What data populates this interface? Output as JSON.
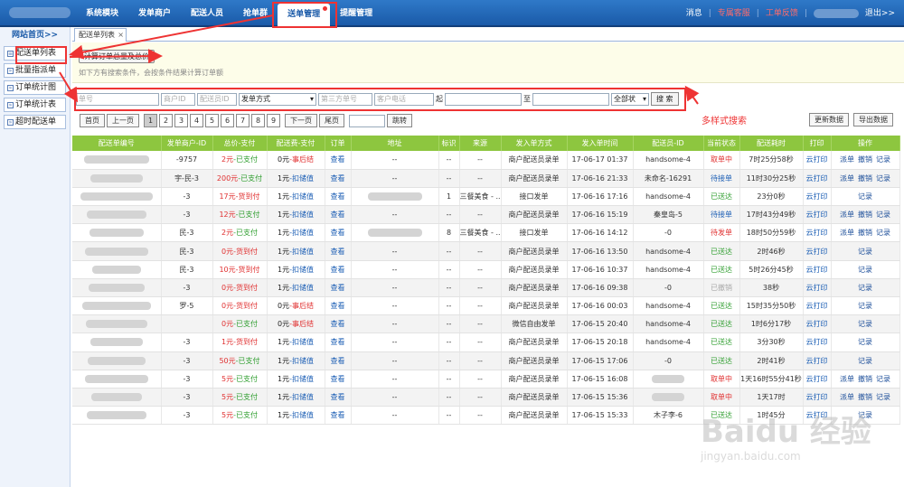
{
  "topnav": {
    "items": [
      "系统模块",
      "发单商户",
      "配送人员",
      "抢单群",
      "送单管理",
      "提醒管理"
    ],
    "active_index": 4,
    "right": {
      "message": "消息",
      "support": "专属客服",
      "feedback": "工单反馈",
      "logout": "退出>>"
    }
  },
  "sidebar": {
    "home": "网站首页>>",
    "items": [
      "配送单列表",
      "批量指派单",
      "订单统计图",
      "订单统计表",
      "超时配送单"
    ]
  },
  "tab": {
    "label": "配送单列表",
    "close": "×"
  },
  "panel": {
    "calc_button": "计算订单总量及总价",
    "hint": "如下方有搜索条件，会按条件结果计算订单额"
  },
  "search": {
    "order_no": "单号",
    "merchant_id": "商户ID",
    "courier_id": "配送员ID",
    "send_type": "发单方式",
    "third_no": "第三方单号",
    "phone": "客户电话",
    "from": "起",
    "to": "至",
    "status": "全部状",
    "button": "搜 索",
    "multi_label": "多样式搜索"
  },
  "pager": {
    "first": "首页",
    "prev": "上一页",
    "pages": [
      "1",
      "2",
      "3",
      "4",
      "5",
      "6",
      "7",
      "8",
      "9"
    ],
    "current": "1",
    "next": "下一页",
    "last": "尾页",
    "jump": "跳转",
    "refresh": "更新数据",
    "export": "导出数据"
  },
  "table": {
    "headers": [
      "配送单编号",
      "发单商户-ID",
      "总价-支付",
      "配送费-支付",
      "订单",
      "地址",
      "标识",
      "来源",
      "发入单方式",
      "发入单时间",
      "配送员-ID",
      "当前状态",
      "配送耗时",
      "打印",
      "操作"
    ],
    "rows": [
      {
        "merchant": "-9757",
        "total": "2元",
        "total_pay": "-已支付",
        "fee": "0元",
        "fee_pay": "-事后结",
        "view": "查看",
        "addr": "--",
        "mark": "--",
        "src": "--",
        "way": "商户配送员录单",
        "time": "17-06-17 01:37",
        "courier": "handsome-4",
        "status": "取单中",
        "dur": "7时25分58秒",
        "print": "云打印",
        "ops": [
          "派单",
          "撤销",
          "记录"
        ]
      },
      {
        "merchant": "宇-民-3",
        "total": "200元",
        "total_pay": "-已支付",
        "fee": "1元",
        "fee_pay": "-扣储值",
        "view": "查看",
        "addr": "--",
        "mark": "--",
        "src": "--",
        "way": "商户配送员录单",
        "time": "17-06-16 21:33",
        "courier": "未命名-16291",
        "status": "待接单",
        "dur": "11时30分25秒",
        "print": "云打印",
        "ops": [
          "派单",
          "撤销",
          "记录"
        ]
      },
      {
        "merchant": "-3",
        "total": "17元",
        "total_pay": "-货到付",
        "fee": "1元",
        "fee_pay": "-扣储值",
        "view": "查看",
        "addr": "",
        "mark": "1",
        "src": "三餐美食 - ...",
        "way": "接口发单",
        "time": "17-06-16 17:16",
        "courier": "handsome-4",
        "status": "已送达",
        "dur": "23分0秒",
        "print": "云打印",
        "ops": [
          "记录"
        ]
      },
      {
        "merchant": "-3",
        "total": "12元",
        "total_pay": "-已支付",
        "fee": "1元",
        "fee_pay": "-扣储值",
        "view": "查看",
        "addr": "--",
        "mark": "--",
        "src": "--",
        "way": "商户配送员录单",
        "time": "17-06-16 15:19",
        "courier": "秦皇岛-5",
        "status": "待接单",
        "dur": "17时43分49秒",
        "print": "云打印",
        "ops": [
          "派单",
          "撤销",
          "记录"
        ]
      },
      {
        "merchant": "民-3",
        "total": "2元",
        "total_pay": "-已支付",
        "fee": "1元",
        "fee_pay": "-扣储值",
        "view": "查看",
        "addr": "",
        "mark": "8",
        "src": "三餐美食 - ...",
        "way": "接口发单",
        "time": "17-06-16 14:12",
        "courier": "-0",
        "status": "待发单",
        "dur": "18时50分59秒",
        "print": "云打印",
        "ops": [
          "派单",
          "撤销",
          "记录"
        ]
      },
      {
        "merchant": "民-3",
        "total": "0元",
        "total_pay": "-货到付",
        "fee": "1元",
        "fee_pay": "-扣储值",
        "view": "查看",
        "addr": "--",
        "mark": "--",
        "src": "--",
        "way": "商户配送员录单",
        "time": "17-06-16 13:50",
        "courier": "handsome-4",
        "status": "已送达",
        "dur": "2时46秒",
        "print": "云打印",
        "ops": [
          "记录"
        ]
      },
      {
        "merchant": "民-3",
        "total": "10元",
        "total_pay": "-货到付",
        "fee": "1元",
        "fee_pay": "-扣储值",
        "view": "查看",
        "addr": "--",
        "mark": "--",
        "src": "--",
        "way": "商户配送员录单",
        "time": "17-06-16 10:37",
        "courier": "handsome-4",
        "status": "已送达",
        "dur": "5时26分45秒",
        "print": "云打印",
        "ops": [
          "记录"
        ]
      },
      {
        "merchant": "-3",
        "total": "0元",
        "total_pay": "-货到付",
        "fee": "1元",
        "fee_pay": "-扣储值",
        "view": "查看",
        "addr": "--",
        "mark": "--",
        "src": "--",
        "way": "商户配送员录单",
        "time": "17-06-16 09:38",
        "courier": "-0",
        "status": "已撤销",
        "dur": "38秒",
        "print": "云打印",
        "ops": [
          "记录"
        ]
      },
      {
        "merchant": "罗-5",
        "total": "0元",
        "total_pay": "-货到付",
        "fee": "0元",
        "fee_pay": "-事后结",
        "view": "查看",
        "addr": "--",
        "mark": "--",
        "src": "--",
        "way": "商户配送员录单",
        "time": "17-06-16 00:03",
        "courier": "handsome-4",
        "status": "已送达",
        "dur": "15时35分50秒",
        "print": "云打印",
        "ops": [
          "记录"
        ]
      },
      {
        "merchant": "",
        "total": "0元",
        "total_pay": "-已支付",
        "fee": "0元",
        "fee_pay": "-事后结",
        "view": "查看",
        "addr": "--",
        "mark": "--",
        "src": "--",
        "way": "微信自由发单",
        "time": "17-06-15 20:40",
        "courier": "handsome-4",
        "status": "已送达",
        "dur": "1时6分17秒",
        "print": "云打印",
        "ops": [
          "记录"
        ]
      },
      {
        "merchant": "-3",
        "total": "1元",
        "total_pay": "-货到付",
        "fee": "1元",
        "fee_pay": "-扣储值",
        "view": "查看",
        "addr": "--",
        "mark": "--",
        "src": "--",
        "way": "商户配送员录单",
        "time": "17-06-15 20:18",
        "courier": "handsome-4",
        "status": "已送达",
        "dur": "3分30秒",
        "print": "云打印",
        "ops": [
          "记录"
        ]
      },
      {
        "merchant": "-3",
        "total": "50元",
        "total_pay": "-已支付",
        "fee": "1元",
        "fee_pay": "-扣储值",
        "view": "查看",
        "addr": "--",
        "mark": "--",
        "src": "--",
        "way": "商户配送员录单",
        "time": "17-06-15 17:06",
        "courier": "-0",
        "status": "已送达",
        "dur": "2时41秒",
        "print": "云打印",
        "ops": [
          "记录"
        ]
      },
      {
        "merchant": "-3",
        "total": "5元",
        "total_pay": "-已支付",
        "fee": "1元",
        "fee_pay": "-扣储值",
        "view": "查看",
        "addr": "--",
        "mark": "--",
        "src": "--",
        "way": "商户配送员录单",
        "time": "17-06-15 16:08",
        "courier": "",
        "status": "取单中",
        "dur": "1天16时55分41秒",
        "print": "云打印",
        "ops": [
          "派单",
          "撤销",
          "记录"
        ]
      },
      {
        "merchant": "-3",
        "total": "5元",
        "total_pay": "-已支付",
        "fee": "1元",
        "fee_pay": "-扣储值",
        "view": "查看",
        "addr": "--",
        "mark": "--",
        "src": "--",
        "way": "商户配送员录单",
        "time": "17-06-15 15:36",
        "courier": "",
        "status": "取单中",
        "dur": "1天17时",
        "print": "云打印",
        "ops": [
          "派单",
          "撤销",
          "记录"
        ]
      },
      {
        "merchant": "-3",
        "total": "5元",
        "total_pay": "-已支付",
        "fee": "1元",
        "fee_pay": "-扣储值",
        "view": "查看",
        "addr": "--",
        "mark": "--",
        "src": "--",
        "way": "商户配送员录单",
        "time": "17-06-15 15:33",
        "courier": "木子李-6",
        "status": "已送达",
        "dur": "1时45分",
        "print": "云打印",
        "ops": [
          "记录"
        ]
      }
    ]
  },
  "watermark": {
    "big": "Baidu 经验",
    "small": "jingyan.baidu.com"
  }
}
